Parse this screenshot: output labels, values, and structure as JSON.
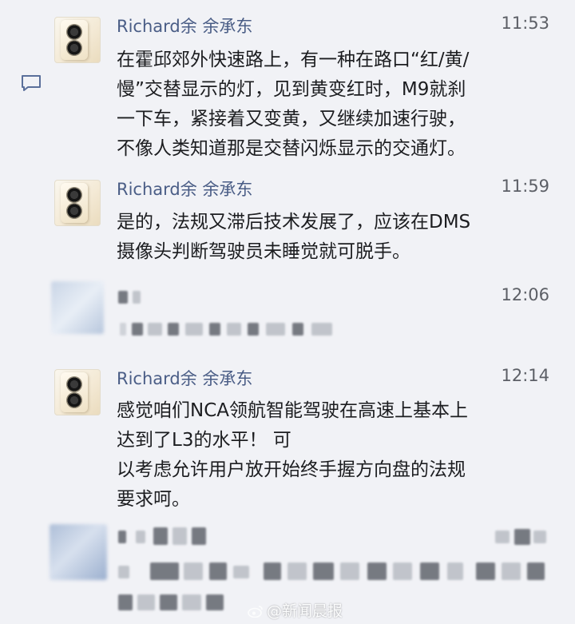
{
  "messages": [
    {
      "sender": "Richard余 余承东",
      "time": "11:53",
      "lines": [
        "在霍邱郊外快速路上，有一种在路口“红/黄/",
        "慢”交替显示的灯，见到黄变红时，M9就刹",
        "一下车，紧接着又变黄，又继续加速行驶，",
        "不像人类知道那是交替闪烁显示的交通灯。"
      ]
    },
    {
      "sender": "Richard余 余承东",
      "time": "11:59",
      "lines": [
        "是的，法规又滞后技术发展了，应该在DMS",
        "摄像头判断驾驶员未睡觉就可脱手。"
      ]
    },
    {
      "sender": "",
      "time": "12:06",
      "lines": []
    },
    {
      "sender": "Richard余 余承东",
      "time": "12:14",
      "lines": [
        "感觉咱们NCA领航智能驾驶在高速上基本上",
        "达到了L3的水平！ 可",
        "以考虑允许用户放开始终手握方向盘的法规",
        "要求呵。"
      ]
    }
  ],
  "watermark": "@新闻晨报",
  "icons": {
    "comment": "comment-icon",
    "weibo": "weibo-logo-icon"
  },
  "colors": {
    "background": "#f1f2f6",
    "sender": "#4a5d86",
    "time": "#5c5f66",
    "text": "#1c1d20"
  }
}
